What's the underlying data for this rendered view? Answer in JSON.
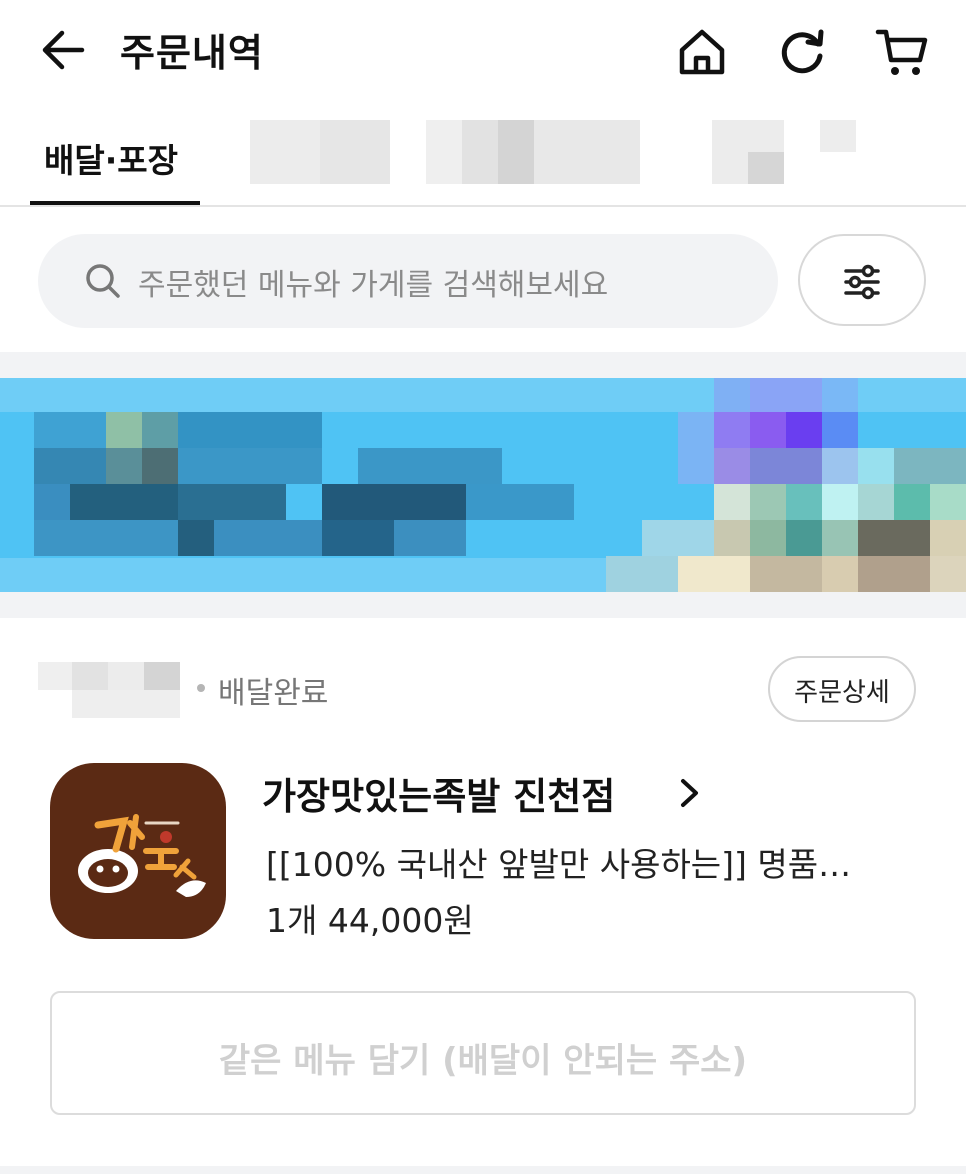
{
  "header": {
    "title": "주문내역",
    "icons": [
      "back-arrow-icon",
      "home-icon",
      "refresh-icon",
      "cart-icon"
    ]
  },
  "tabs": {
    "active_label": "배달·포장"
  },
  "search": {
    "placeholder": "주문했던 메뉴와 가게를 검색해보세요"
  },
  "order": {
    "status": "배달완료",
    "detail_button": "주문상세",
    "store_name": "가장맛있는족발 진천점",
    "menu": "[[100% 국내산 앞발만 사용하는]] 명품…",
    "price": "1개 44,000원",
    "reorder_button": "같은 메뉴 담기 (배달이 안되는 주소)"
  },
  "colors": {
    "text": "#111111",
    "muted": "#8a8a8a",
    "search_bg": "#f2f3f5",
    "logo_bg": "#5b2a14",
    "banner_bg": "#4fc3f4",
    "disabled_text": "#d0d0d0"
  }
}
